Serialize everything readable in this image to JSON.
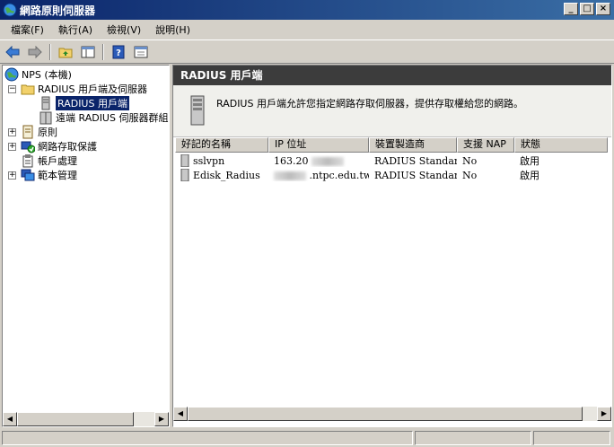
{
  "window": {
    "title": "網路原則伺服器",
    "min": "_",
    "max": "□",
    "close": "×"
  },
  "menu": [
    "檔案(F)",
    "執行(A)",
    "檢視(V)",
    "說明(H)"
  ],
  "toolbar": {
    "icons": [
      "back-arrow-icon",
      "forward-arrow-icon",
      "up-folder-icon",
      "show-hide-tree-icon",
      "help-icon",
      "properties-icon"
    ]
  },
  "tree": {
    "root": "NPS (本機)",
    "radius_group": "RADIUS 用戶端及伺服器",
    "radius_clients": "RADIUS 用戶端",
    "remote_groups": "遠端 RADIUS 伺服器群組",
    "policies": "原則",
    "nap": "網路存取保護",
    "accounting": "帳戶處理",
    "templates": "範本管理"
  },
  "panel": {
    "header": "RADIUS 用戶端",
    "description": "RADIUS 用戶端允許您指定網路存取伺服器，提供存取權給您的網路。"
  },
  "table": {
    "columns": [
      "好記的名稱",
      "IP 位址",
      "裝置製造商",
      "支援 NAP",
      "狀態"
    ],
    "rows": [
      {
        "name": "sslvpn",
        "ip": "163.20",
        "vendor": "RADIUS Standard",
        "nap": "No",
        "status": "啟用"
      },
      {
        "name": "Edisk_Radius",
        "ip": ".ntpc.edu.tw",
        "vendor": "RADIUS Standard",
        "nap": "No",
        "status": "啟用"
      }
    ]
  }
}
